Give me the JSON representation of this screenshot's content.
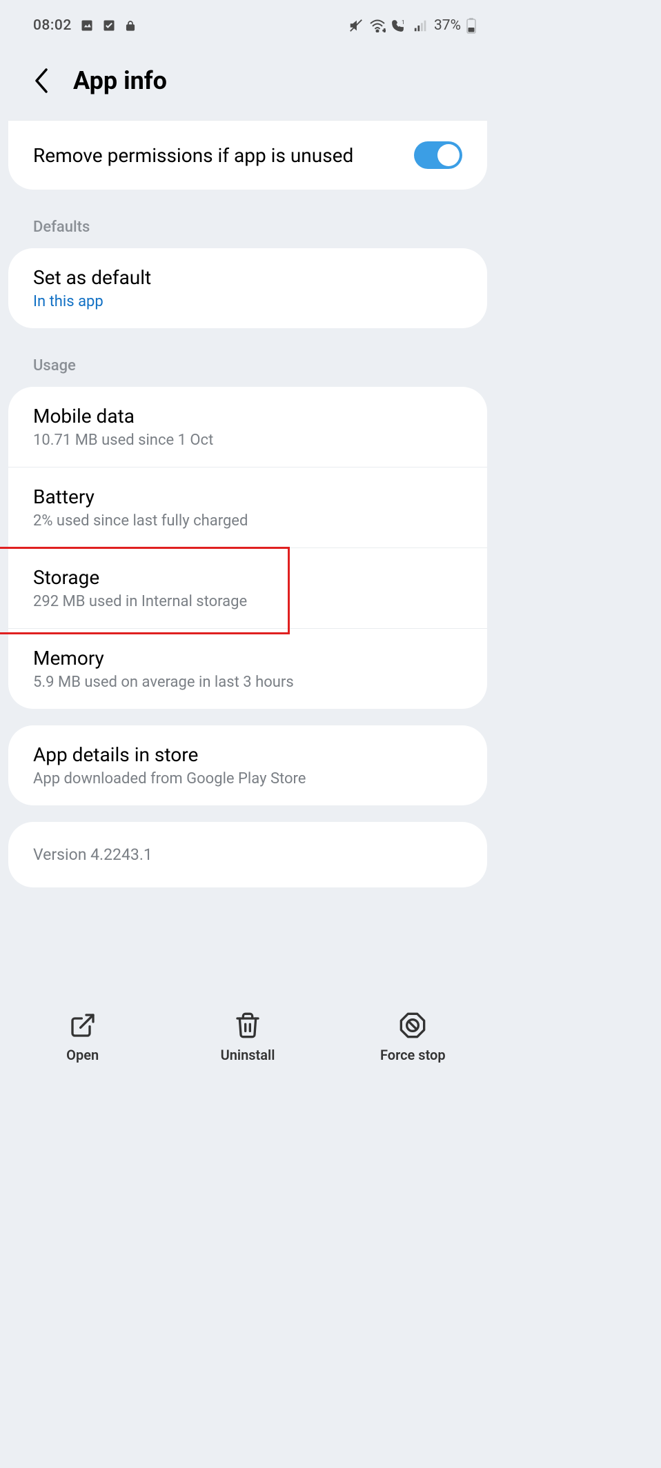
{
  "status": {
    "time": "08:02",
    "battery_pct": "37%"
  },
  "header": {
    "title": "App info"
  },
  "remove_permissions": {
    "label": "Remove permissions if app is unused",
    "enabled": true
  },
  "sections": {
    "defaults_label": "Defaults",
    "usage_label": "Usage"
  },
  "defaults": {
    "title": "Set as default",
    "sub": "In this app"
  },
  "usage": {
    "mobile_data": {
      "title": "Mobile data",
      "sub": "10.71 MB used since 1 Oct"
    },
    "battery": {
      "title": "Battery",
      "sub": "2% used since last fully charged"
    },
    "storage": {
      "title": "Storage",
      "sub": "292 MB used in Internal storage"
    },
    "memory": {
      "title": "Memory",
      "sub": "5.9 MB used on average in last 3 hours"
    }
  },
  "store": {
    "title": "App details in store",
    "sub": "App downloaded from Google Play Store"
  },
  "version": {
    "text": "Version 4.2243.1"
  },
  "bottom": {
    "open": "Open",
    "uninstall": "Uninstall",
    "force_stop": "Force stop"
  }
}
